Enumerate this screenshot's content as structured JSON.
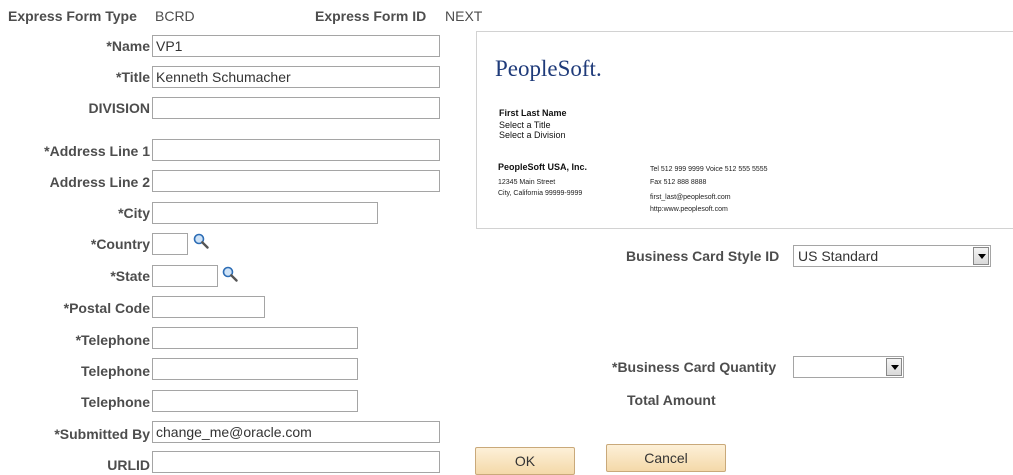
{
  "header": {
    "form_type_label": "Express Form Type",
    "form_type_value": "BCRD",
    "form_id_label": "Express Form ID",
    "form_id_value": "NEXT"
  },
  "form": {
    "name": {
      "label": "*Name",
      "value": "VP1"
    },
    "title": {
      "label": "*Title",
      "value": "Kenneth Schumacher"
    },
    "division": {
      "label": "DIVISION",
      "value": ""
    },
    "address1": {
      "label": "*Address Line 1",
      "value": ""
    },
    "address2": {
      "label": "Address Line 2",
      "value": ""
    },
    "city": {
      "label": "*City",
      "value": ""
    },
    "country": {
      "label": "*Country",
      "value": ""
    },
    "state": {
      "label": "*State",
      "value": ""
    },
    "postal": {
      "label": "*Postal Code",
      "value": ""
    },
    "telephone1": {
      "label": "*Telephone",
      "value": ""
    },
    "telephone2": {
      "label": "Telephone",
      "value": ""
    },
    "telephone3": {
      "label": "Telephone",
      "value": ""
    },
    "submitted_by": {
      "label": "*Submitted By",
      "value": "change_me@oracle.com"
    },
    "urlid": {
      "label": "URLID",
      "value": ""
    }
  },
  "card_preview": {
    "logo": "PeopleSoft.",
    "name": "First Last Name",
    "title": "Select a Title",
    "division": "Select a Division",
    "company": "PeopleSoft USA, Inc.",
    "street": "12345 Main Street",
    "city_line": "City, California 99999-9999",
    "tel_line": "Tel 512 999 9999  Voice 512 555 5555",
    "fax_line": "Fax 512 888 8888",
    "email_line": "first_last@peoplesoft.com",
    "web_line": "http:www.peoplesoft.com"
  },
  "card_options": {
    "style_label": "Business Card Style ID",
    "style_value": "US Standard",
    "quantity_label": "*Business Card Quantity",
    "quantity_value": "",
    "total_label": "Total Amount"
  },
  "buttons": {
    "ok": "OK",
    "cancel": "Cancel"
  },
  "colors": {
    "label": "#4d4d4d",
    "button_bg": "#f4d9a9",
    "logo": "#1f3b7a"
  }
}
